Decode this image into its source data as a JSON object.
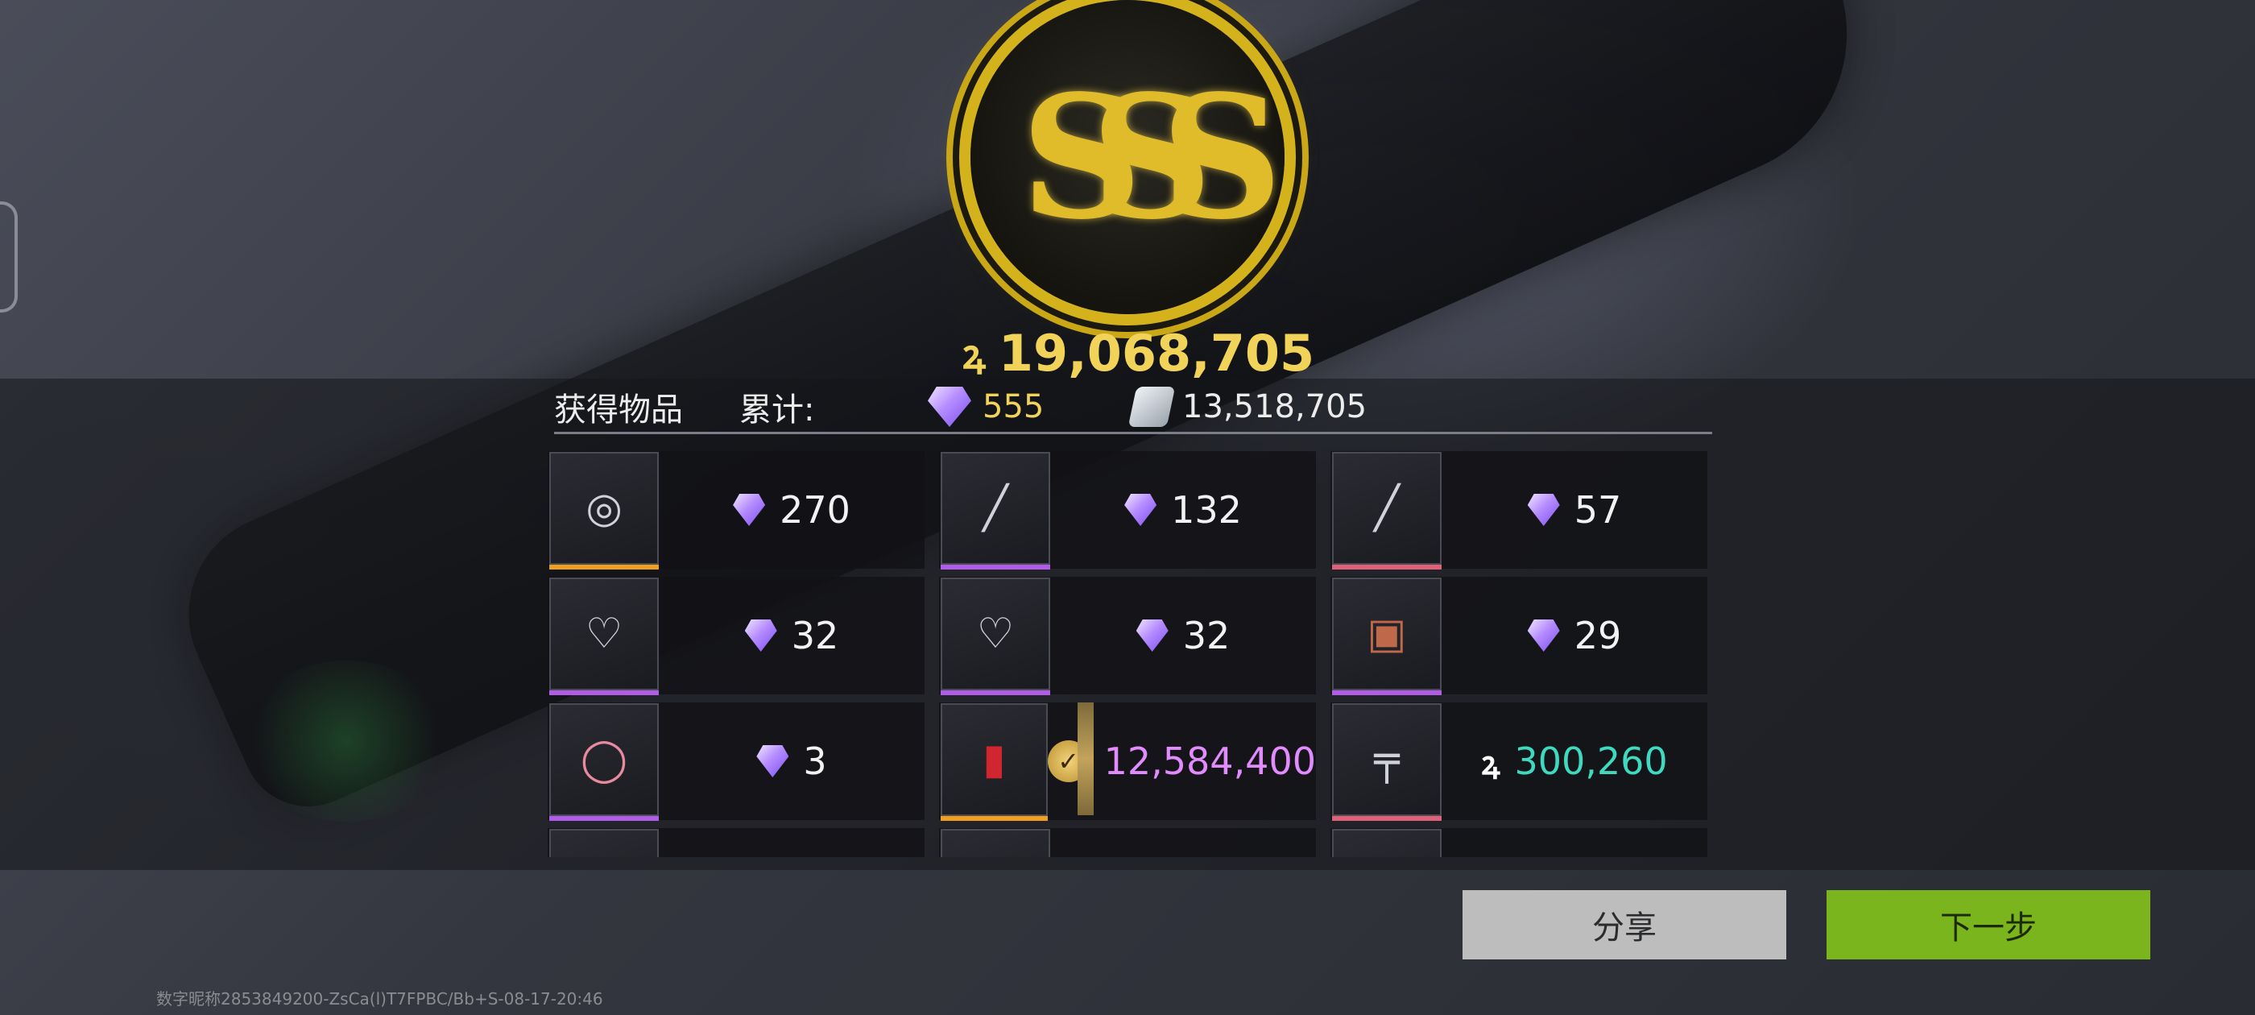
{
  "total": {
    "icon": "coin-glyph",
    "value": "19,068,705",
    "glyph": "ꝝ"
  },
  "header": {
    "title": "获得物品",
    "cumulative_label": "累计:",
    "gem_total": "555",
    "silver_total": "13,518,705"
  },
  "items": [
    {
      "icon": "coin-item-icon",
      "value": "270",
      "currency": "gem",
      "rarity_color": "#f0a020"
    },
    {
      "icon": "syringe-item-icon",
      "value": "132",
      "currency": "gem",
      "rarity_color": "#b05ce8"
    },
    {
      "icon": "rifle-item-icon",
      "value": "57",
      "currency": "gem",
      "rarity_color": "#e0607a"
    },
    {
      "icon": "heart-necklace-icon",
      "value": "32",
      "currency": "gem",
      "rarity_color": "#b05ce8"
    },
    {
      "icon": "heart-necklace-icon",
      "value": "32",
      "currency": "gem",
      "rarity_color": "#b05ce8"
    },
    {
      "icon": "ornate-box-icon",
      "value": "29",
      "currency": "gem",
      "rarity_color": "#b05ce8"
    },
    {
      "icon": "bracelet-icon",
      "value": "3",
      "currency": "gem",
      "rarity_color": "#b05ce8"
    },
    {
      "icon": "red-canister-icon",
      "value": "12,584,400",
      "currency": "badge",
      "rarity_color": "#f0a020"
    },
    {
      "icon": "assault-rifle-icon",
      "value": "300,260",
      "currency": "coin",
      "rarity_color": "#e0607a"
    }
  ],
  "buttons": {
    "share": "分享",
    "next": "下一步"
  },
  "footer": {
    "watermark": "数字昵称2853849200-ZsCa(l)T7FPBC/Bb+S-08-17-20:46"
  },
  "colors": {
    "gold": "#f2d35a",
    "next_button": "#7ab51d",
    "share_button": "#bdbdbd",
    "teal_value": "#3fd9c0",
    "purple_value": "#e18bff"
  }
}
